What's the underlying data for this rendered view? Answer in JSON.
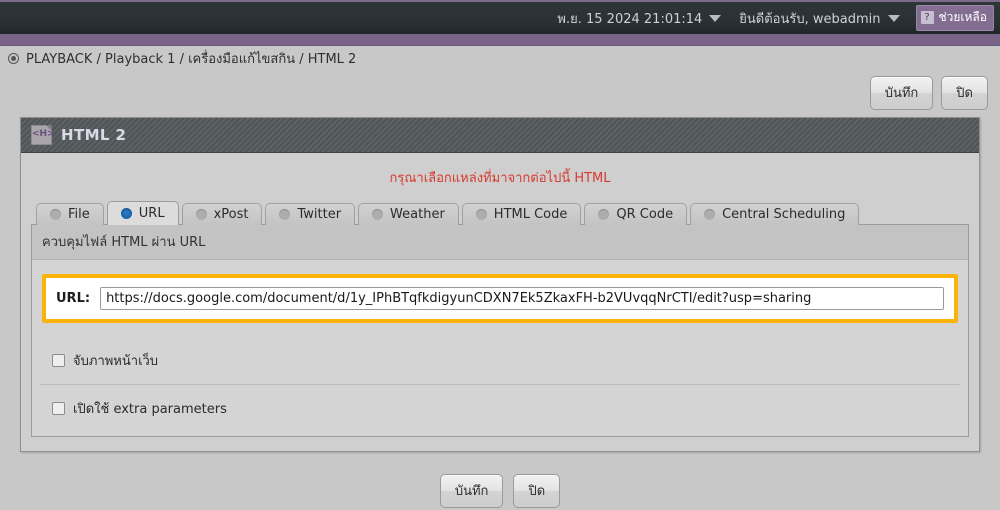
{
  "topbar": {
    "datetime": "พ.ย. 15 2024 21:01:14",
    "user_greeting": "ยินดีต้อนรับ, webadmin",
    "help_label": "ช่วยเหลือ",
    "help_icon_glyph": "?"
  },
  "breadcrumb": {
    "text": "PLAYBACK / Playback 1 / เครื่องมือแก้ไขสกิน / HTML 2"
  },
  "top_actions": {
    "save_label": "บันทึก",
    "close_label": "ปิด"
  },
  "panel": {
    "title": "HTML 2",
    "icon_text": "<H>",
    "notice": "กรุณาเลือกแหล่งที่มาจากต่อไปนี้ HTML",
    "tabs": [
      {
        "label": "File",
        "selected": false
      },
      {
        "label": "URL",
        "selected": true
      },
      {
        "label": "xPost",
        "selected": false
      },
      {
        "label": "Twitter",
        "selected": false
      },
      {
        "label": "Weather",
        "selected": false
      },
      {
        "label": "HTML Code",
        "selected": false
      },
      {
        "label": "QR Code",
        "selected": false
      },
      {
        "label": "Central Scheduling",
        "selected": false
      }
    ],
    "section_header": "ควบคุมไฟล์ HTML ผ่าน URL",
    "url_field": {
      "label": "URL:",
      "value": "https://docs.google.com/document/d/1y_IPhBTqfkdigyunCDXN7Ek5ZkaxFH-b2VUvqqNrCTI/edit?usp=sharing",
      "placeholder": "",
      "highlight_color": "#f9b309"
    },
    "checkboxes": [
      {
        "label": "จับภาพหน้าเว็บ",
        "checked": false
      },
      {
        "label": "เปิดใช้ extra parameters",
        "checked": false
      }
    ]
  },
  "bottom_actions": {
    "save_label": "บันทึก",
    "close_label": "ปิด"
  },
  "colors": {
    "topbar_bg": "#2b3236",
    "accent_purple": "#7a6389",
    "notice_red": "#d83a2e",
    "highlight_amber": "#f9b309",
    "radio_selected_blue": "#1666aa"
  }
}
